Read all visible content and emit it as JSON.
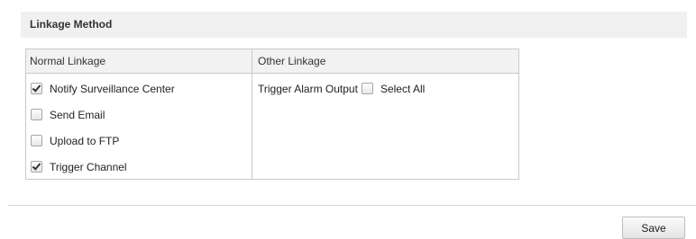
{
  "section": {
    "title": "Linkage Method"
  },
  "normal_linkage": {
    "header": "Normal Linkage",
    "options": [
      {
        "label": "Notify Surveillance Center",
        "checked": true
      },
      {
        "label": "Send Email",
        "checked": false
      },
      {
        "label": "Upload to FTP",
        "checked": false
      },
      {
        "label": "Trigger Channel",
        "checked": true
      }
    ]
  },
  "other_linkage": {
    "header": "Other Linkage",
    "trigger_label": "Trigger Alarm Output",
    "select_all_label": "Select All",
    "select_all_checked": false
  },
  "footer": {
    "save_label": "Save"
  }
}
